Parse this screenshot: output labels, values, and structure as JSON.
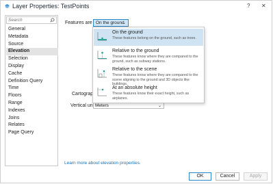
{
  "window": {
    "title": "Layer Properties: TestPoints",
    "help_label": "?",
    "close_label": "✕"
  },
  "sidebar": {
    "search_placeholder": "Search",
    "items": [
      {
        "label": "General"
      },
      {
        "label": "Metadata"
      },
      {
        "label": "Source"
      },
      {
        "label": "Elevation"
      },
      {
        "label": "Selection"
      },
      {
        "label": "Display"
      },
      {
        "label": "Cache"
      },
      {
        "label": "Definition Query"
      },
      {
        "label": "Time"
      },
      {
        "label": "Floors"
      },
      {
        "label": "Range"
      },
      {
        "label": "Indexes"
      },
      {
        "label": "Joins"
      },
      {
        "label": "Relates"
      },
      {
        "label": "Page Query"
      }
    ],
    "selected": "Elevation"
  },
  "main": {
    "features_label": "Features are",
    "features_value": "On the ground",
    "cartographic_label": "Cartographic",
    "vertical_units_label": "Vertical units",
    "vertical_units_value": "Meters",
    "learn_more": "Learn more about elevation properties."
  },
  "popup": {
    "options": [
      {
        "title": "On the ground",
        "desc": "These features belong on the ground, such as trees.",
        "icon": "on-ground-icon"
      },
      {
        "title": "Relative to the ground",
        "desc": "These features know where they are compared to the ground, such as subway stations.",
        "icon": "relative-ground-icon"
      },
      {
        "title": "Relative to the scene",
        "desc": "These features know where they are compared to the scene aligning to the ground and 3D objects like buildings.",
        "icon": "relative-scene-icon"
      },
      {
        "title": "At an absolute height",
        "desc": "These features know their exact height, such as airplanes.",
        "icon": "absolute-height-icon"
      }
    ]
  },
  "footer": {
    "ok_label": "OK",
    "cancel_label": "Cancel",
    "apply_label": "Apply"
  },
  "colors": {
    "accent": "#2a86c6",
    "selected_option": "#cfe3f3",
    "link": "#1f6fb2",
    "icon_teal": "#2aa39a"
  }
}
